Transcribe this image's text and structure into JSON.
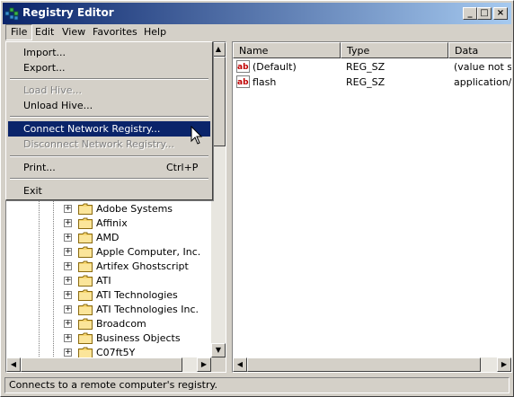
{
  "window": {
    "title": "Registry Editor",
    "controls": {
      "minimize": "_",
      "maximize": "□",
      "close": "×"
    }
  },
  "menubar": [
    "File",
    "Edit",
    "View",
    "Favorites",
    "Help"
  ],
  "file_menu": {
    "import": "Import...",
    "export": "Export...",
    "load_hive": "Load Hive...",
    "unload_hive": "Unload Hive...",
    "connect_network": "Connect Network Registry...",
    "disconnect_network": "Disconnect Network Registry...",
    "print": "Print...",
    "print_shortcut": "Ctrl+P",
    "exit": "Exit"
  },
  "tree": {
    "items": [
      "Adobe Systems",
      "Affinix",
      "AMD",
      "Apple Computer, Inc.",
      "Artifex Ghostscript",
      "ATI",
      "ATI Technologies",
      "ATI Technologies Inc.",
      "Broadcom",
      "Business Objects",
      "C07ft5Y"
    ],
    "expander": "+"
  },
  "list": {
    "columns": [
      "Name",
      "Type",
      "Data"
    ],
    "rows": [
      {
        "name": "(Default)",
        "type": "REG_SZ",
        "data": "(value not se"
      },
      {
        "name": "flash",
        "type": "REG_SZ",
        "data": "application/x"
      }
    ]
  },
  "statusbar": {
    "text": "Connects to a remote computer's registry."
  },
  "colors": {
    "titlebar_start": "#0a246a",
    "titlebar_end": "#a6caf0",
    "highlight": "#0a246a",
    "face": "#d4d0c8"
  }
}
